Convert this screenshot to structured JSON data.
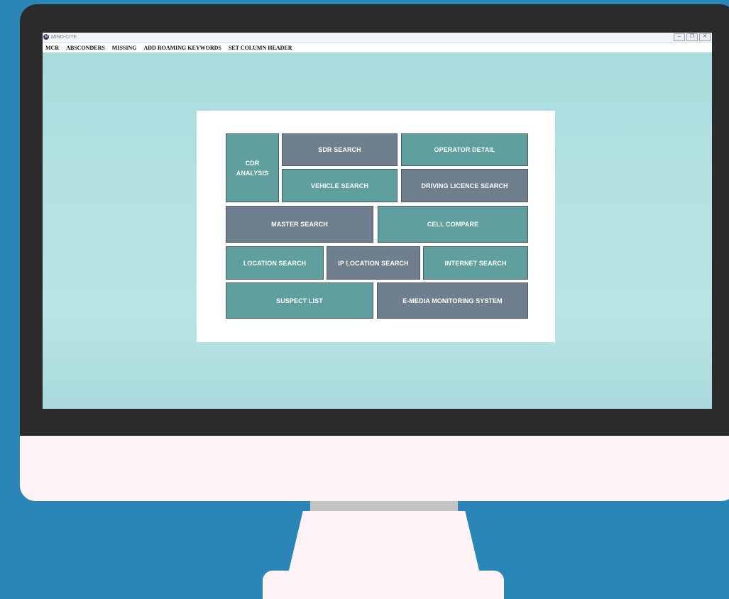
{
  "window": {
    "title": "MIND-CITE",
    "app_icon": "M",
    "controls": [
      "–",
      "❐",
      "✕"
    ]
  },
  "menu": [
    "MCR",
    "ABSCONDERS",
    "MISSING",
    "ADD ROAMING KEYWORDS",
    "SET COLUMN HEADER"
  ],
  "tiles": {
    "cdr_analysis": "CDR\nANALYSIS",
    "sdr_search": "SDR SEARCH",
    "operator_detail": "OPERATOR DETAIL",
    "vehicle_search": "VEHICLE SEARCH",
    "driving_licence_search": "DRIVING LICENCE SEARCH",
    "master_search": "MASTER SEARCH",
    "cell_compare": "CELL COMPARE",
    "location_search": "LOCATION SEARCH",
    "ip_location_search": "IP LOCATION SEARCH",
    "internet_search": "INTERNET SEARCH",
    "suspect_list": "SUSPECT LIST",
    "e_media_monitoring_system": "E-MEDIA MONITORING SYSTEM"
  },
  "colors": {
    "teal_tile": "#5f9f9d",
    "slate_tile": "#6f7f8e",
    "background": "#2b86b8",
    "screen": "#b4e1e2"
  }
}
